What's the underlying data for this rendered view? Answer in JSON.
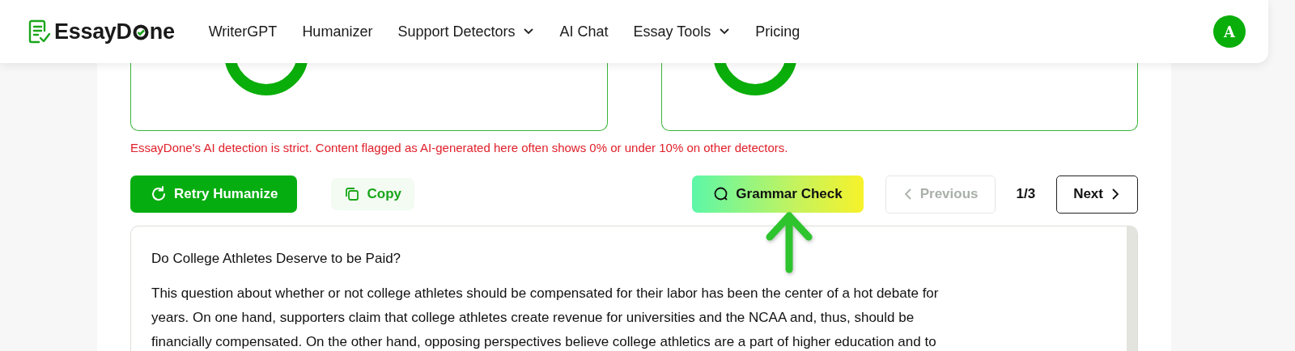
{
  "nav": {
    "logo": {
      "left": "EssayD",
      "right": "ne"
    },
    "items": [
      {
        "label": "WriterGPT",
        "dropdown": false
      },
      {
        "label": "Humanizer",
        "dropdown": false
      },
      {
        "label": "Support Detectors",
        "dropdown": true
      },
      {
        "label": "AI Chat",
        "dropdown": false
      },
      {
        "label": "Essay Tools",
        "dropdown": true
      },
      {
        "label": "Pricing",
        "dropdown": false
      }
    ],
    "avatar": "A"
  },
  "notice": "EssayDone's AI detection is strict. Content flagged as AI-generated here often shows 0% or under 10% on other detectors.",
  "actions": {
    "retry": "Retry Humanize",
    "copy": "Copy",
    "grammar": "Grammar Check",
    "previous": {
      "label": "Previous",
      "disabled": true
    },
    "page": "1/3",
    "next": {
      "label": "Next",
      "disabled": false
    }
  },
  "essay": {
    "title": "Do College Athletes Deserve to be Paid?",
    "lines": [
      "This question about whether or not college athletes should be compensated for their labor has been the center of a hot debate for",
      "years. On one hand, supporters claim that college athletes create revenue for universities and the NCAA and, thus, should be",
      "financially compensated. On the other hand, opposing perspectives believe college athletics are a part of higher education and to"
    ]
  }
}
